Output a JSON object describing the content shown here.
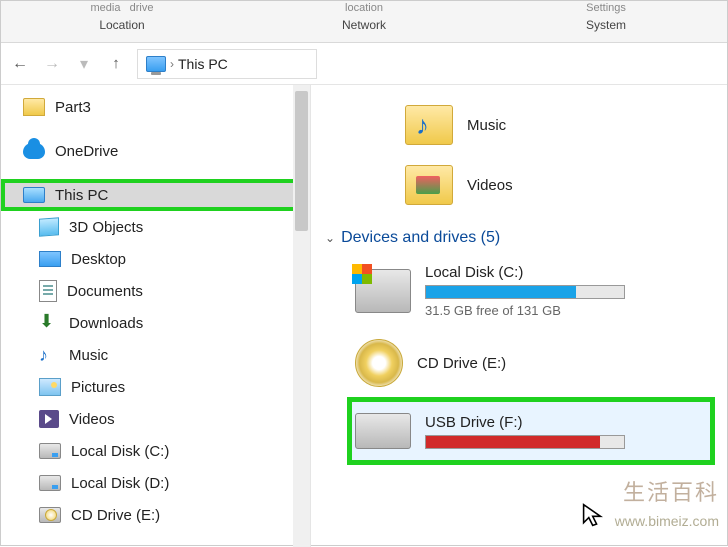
{
  "ribbon": {
    "groups": [
      {
        "top1": "media",
        "top2": "drive",
        "label": "Location"
      },
      {
        "top1": "",
        "top2": "location",
        "label": "Network"
      },
      {
        "top1": "",
        "top2": "Settings",
        "label": "System"
      }
    ]
  },
  "breadcrumb": {
    "segments": [
      "This PC"
    ]
  },
  "tree": {
    "items": [
      {
        "name": "part3",
        "icon": "folder-icon",
        "label": "Part3",
        "child": false
      },
      {
        "name": "onedrive",
        "icon": "cloud-icon",
        "label": "OneDrive",
        "child": false
      },
      {
        "name": "this-pc",
        "icon": "monitor-icon",
        "label": "This PC",
        "child": false,
        "selected": true,
        "highlight": true
      },
      {
        "name": "3d-objects",
        "icon": "cube-icon",
        "label": "3D Objects",
        "child": true
      },
      {
        "name": "desktop",
        "icon": "desktop-icon",
        "label": "Desktop",
        "child": true
      },
      {
        "name": "documents",
        "icon": "doc-icon",
        "label": "Documents",
        "child": true
      },
      {
        "name": "downloads",
        "icon": "download-icon",
        "label": "Downloads",
        "child": true
      },
      {
        "name": "music",
        "icon": "music-icon",
        "label": "Music",
        "child": true
      },
      {
        "name": "pictures",
        "icon": "pic-icon",
        "label": "Pictures",
        "child": true
      },
      {
        "name": "videos",
        "icon": "video-icon",
        "label": "Videos",
        "child": true
      },
      {
        "name": "local-disk-c",
        "icon": "drive-icon local",
        "label": "Local Disk (C:)",
        "child": true
      },
      {
        "name": "local-disk-d",
        "icon": "drive-icon local",
        "label": "Local Disk (D:)",
        "child": true
      },
      {
        "name": "cd-drive-e",
        "icon": "drive-icon cd",
        "label": "CD Drive (E:)",
        "child": true
      }
    ]
  },
  "content": {
    "libraries": [
      {
        "name": "music",
        "label": "Music",
        "cls": "music"
      },
      {
        "name": "videos",
        "label": "Videos",
        "cls": "videos"
      }
    ],
    "section_header": "Devices and drives (5)",
    "drives": {
      "local_c": {
        "label": "Local Disk (C:)",
        "usage_text": "31.5 GB free of 131 GB",
        "fill_pct": 76
      },
      "cd_e": {
        "label": "CD Drive (E:)"
      },
      "usb_f": {
        "label": "USB Drive (F:)",
        "fill_pct": 88
      }
    }
  },
  "watermark": {
    "main": "生活百科",
    "url": "www.bimeiz.com"
  }
}
